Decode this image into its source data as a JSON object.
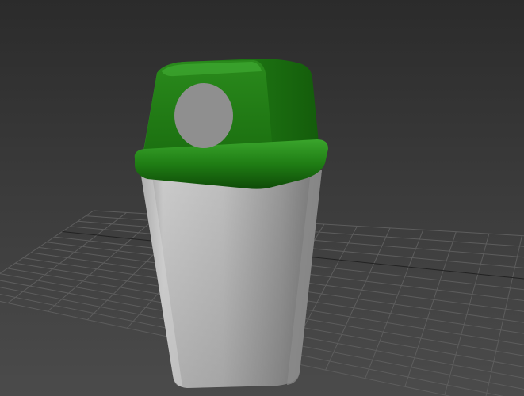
{
  "viewport": {
    "background_top": "#2b2b2b",
    "background_bottom": "#4b4b4b",
    "grid_color": "#5d5d5d",
    "grid_axis_color": "#222222"
  },
  "model": {
    "object": "trash bin",
    "lid_color": "#1e7a12",
    "lid_highlight": "#3fa632",
    "lid_shadow": "#0f4a08",
    "opening_color": "#8f8f8f",
    "body_color": "#b9b9b9",
    "body_shadow": "#8a8a8a"
  }
}
